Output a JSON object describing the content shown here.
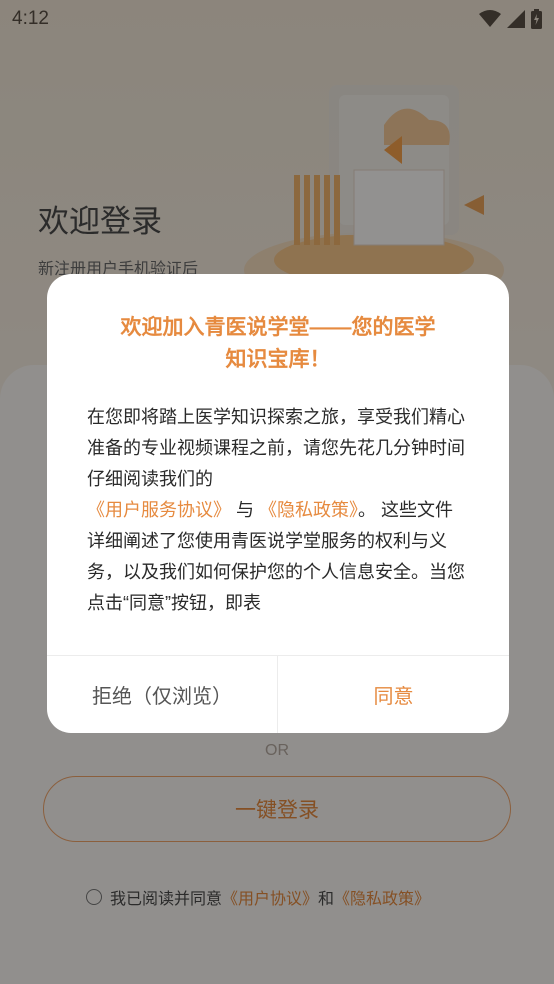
{
  "status_bar": {
    "time": "4:12",
    "icons": [
      "wifi-icon",
      "signal-icon",
      "battery-icon"
    ]
  },
  "login": {
    "title": "欢迎登录",
    "subtitle": "新注册用户手机验证后",
    "or_text": "OR",
    "one_key_label": "一键登录",
    "agree_prefix": "我已阅读并同意",
    "user_agreement": "《用户协议》",
    "and_text": "和",
    "privacy_policy": "《隐私政策》"
  },
  "dialog": {
    "title_line1": "欢迎加入青医说学堂——您的医学",
    "title_line2": "知识宝库！",
    "body_part1": "在您即将踏上医学知识探索之旅，享受我们精心准备的专业视频课程之前，请您先花几分钟时间仔细阅读我们的",
    "service_agreement": "《用户服务协议》",
    "and_text": " 与 ",
    "privacy_policy": "《隐私政策》",
    "body_part2": "。 这些文件详细阐述了您使用青医说学堂服务的权利与义务，以及我们如何保护您的个人信息安全。当您点击“同意”按钮，即表",
    "reject_label": "拒绝（仅浏览）",
    "agree_label": "同意"
  },
  "colors": {
    "accent": "#e68a3f",
    "overlay": "rgba(0,0,0,0.42)"
  }
}
